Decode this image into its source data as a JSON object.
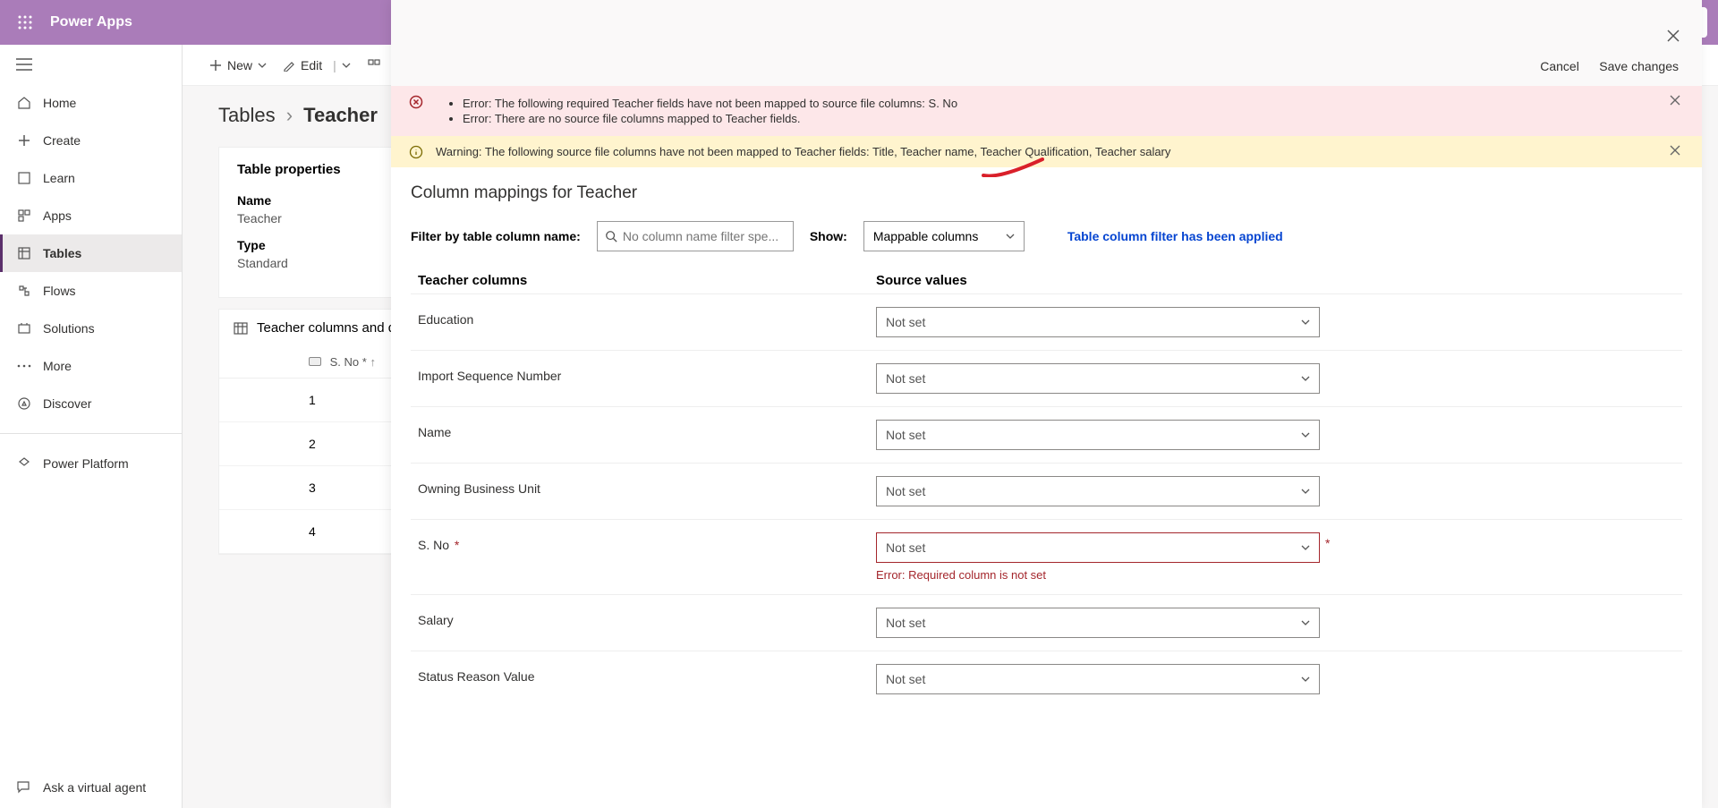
{
  "topbar": {
    "title": "Power Apps"
  },
  "sidebar": {
    "items": [
      {
        "label": "Home"
      },
      {
        "label": "Create"
      },
      {
        "label": "Learn"
      },
      {
        "label": "Apps"
      },
      {
        "label": "Tables"
      },
      {
        "label": "Flows"
      },
      {
        "label": "Solutions"
      },
      {
        "label": "More"
      },
      {
        "label": "Discover"
      }
    ],
    "power": "Power Platform",
    "ask": "Ask a virtual agent"
  },
  "cmdbar": {
    "new": "New",
    "edit": "Edit"
  },
  "breadcrumb": {
    "root": "Tables",
    "current": "Teacher"
  },
  "props": {
    "title": "Table properties",
    "name_label": "Name",
    "name_value": "Teacher",
    "type_label": "Type",
    "type_value": "Standard"
  },
  "cols": {
    "title": "Teacher columns and da",
    "hdr": "S. No *",
    "rows": [
      "1",
      "2",
      "3",
      "4"
    ]
  },
  "dialog": {
    "cancel": "Cancel",
    "save": "Save changes",
    "error1": "Error: The following required Teacher fields have not been mapped to source file columns: S. No",
    "error2": "Error: There are no source file columns mapped to Teacher fields.",
    "warning": "Warning: The following source file columns have not been mapped to Teacher fields: Title, Teacher name, Teacher Qualification, Teacher salary",
    "maptitle": "Column mappings for Teacher",
    "filter_label": "Filter by table column name:",
    "filter_placeholder": "No column name filter spe...",
    "show_label": "Show:",
    "show_value": "Mappable columns",
    "applied": "Table column filter has been applied",
    "hdr1": "Teacher columns",
    "hdr2": "Source values",
    "rowerr": "Error: Required column is not set",
    "notset": "Not set",
    "rows": [
      {
        "label": "Education"
      },
      {
        "label": "Import Sequence Number"
      },
      {
        "label": "Name"
      },
      {
        "label": "Owning Business Unit"
      },
      {
        "label": "S. No",
        "required": true,
        "error": true
      },
      {
        "label": "Salary"
      },
      {
        "label": "Status Reason Value"
      }
    ]
  }
}
